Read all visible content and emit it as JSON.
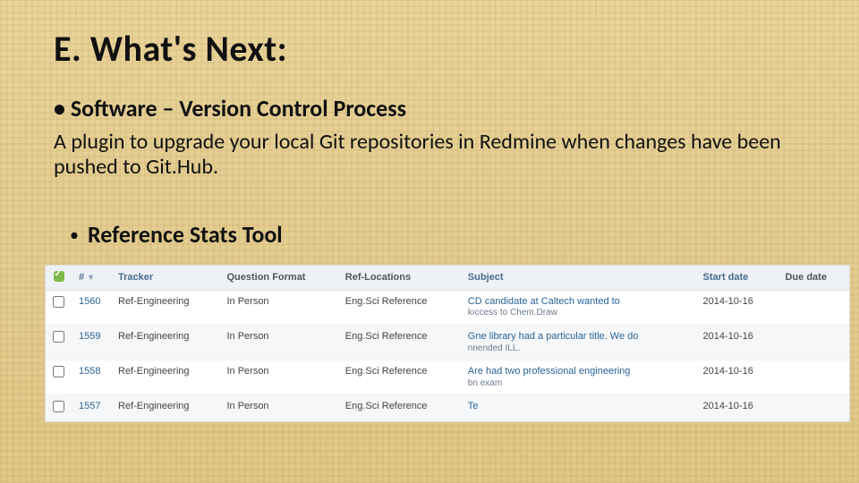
{
  "title": "E. What's Next:",
  "bullet1": "• Software – Version Control Process",
  "body": "A plugin to upgrade your local Git repositories in Redmine when changes have been pushed to Git.Hub.",
  "bullet2_dot": "•",
  "bullet2": "Reference Stats Tool",
  "table": {
    "headers": {
      "hash": "#",
      "tracker": "Tracker",
      "question_format": "Question Format",
      "ref_locations": "Ref-Locations",
      "subject": "Subject",
      "start_date": "Start date",
      "due_date": "Due date"
    },
    "rows": [
      {
        "id": "1560",
        "tracker": "Ref-Engineering",
        "qf": "In Person",
        "loc": "Eng.Sci Reference",
        "subject_line1": "CD candidate at Caltech wanted to",
        "subject_line2": "kıccess to Chem.Draw",
        "start": "2014-10-16",
        "due": ""
      },
      {
        "id": "1559",
        "tracker": "Ref-Engineering",
        "qf": "In Person",
        "loc": "Eng.Sci Reference",
        "subject_line1": "Gne library had a particular title. We do",
        "subject_line2": "nnended ILL.",
        "start": "2014-10-16",
        "due": ""
      },
      {
        "id": "1558",
        "tracker": "Ref-Engineering",
        "qf": "In Person",
        "loc": "Eng.Sci Reference",
        "subject_line1": "Are had two professional engineering",
        "subject_line2": "bn exam",
        "start": "2014-10-16",
        "due": ""
      },
      {
        "id": "1557",
        "tracker": "Ref-Engineering",
        "qf": "In Person",
        "loc": "Eng.Sci Reference",
        "subject_line1": "Te",
        "subject_line2": "",
        "start": "2014-10-16",
        "due": ""
      }
    ]
  }
}
